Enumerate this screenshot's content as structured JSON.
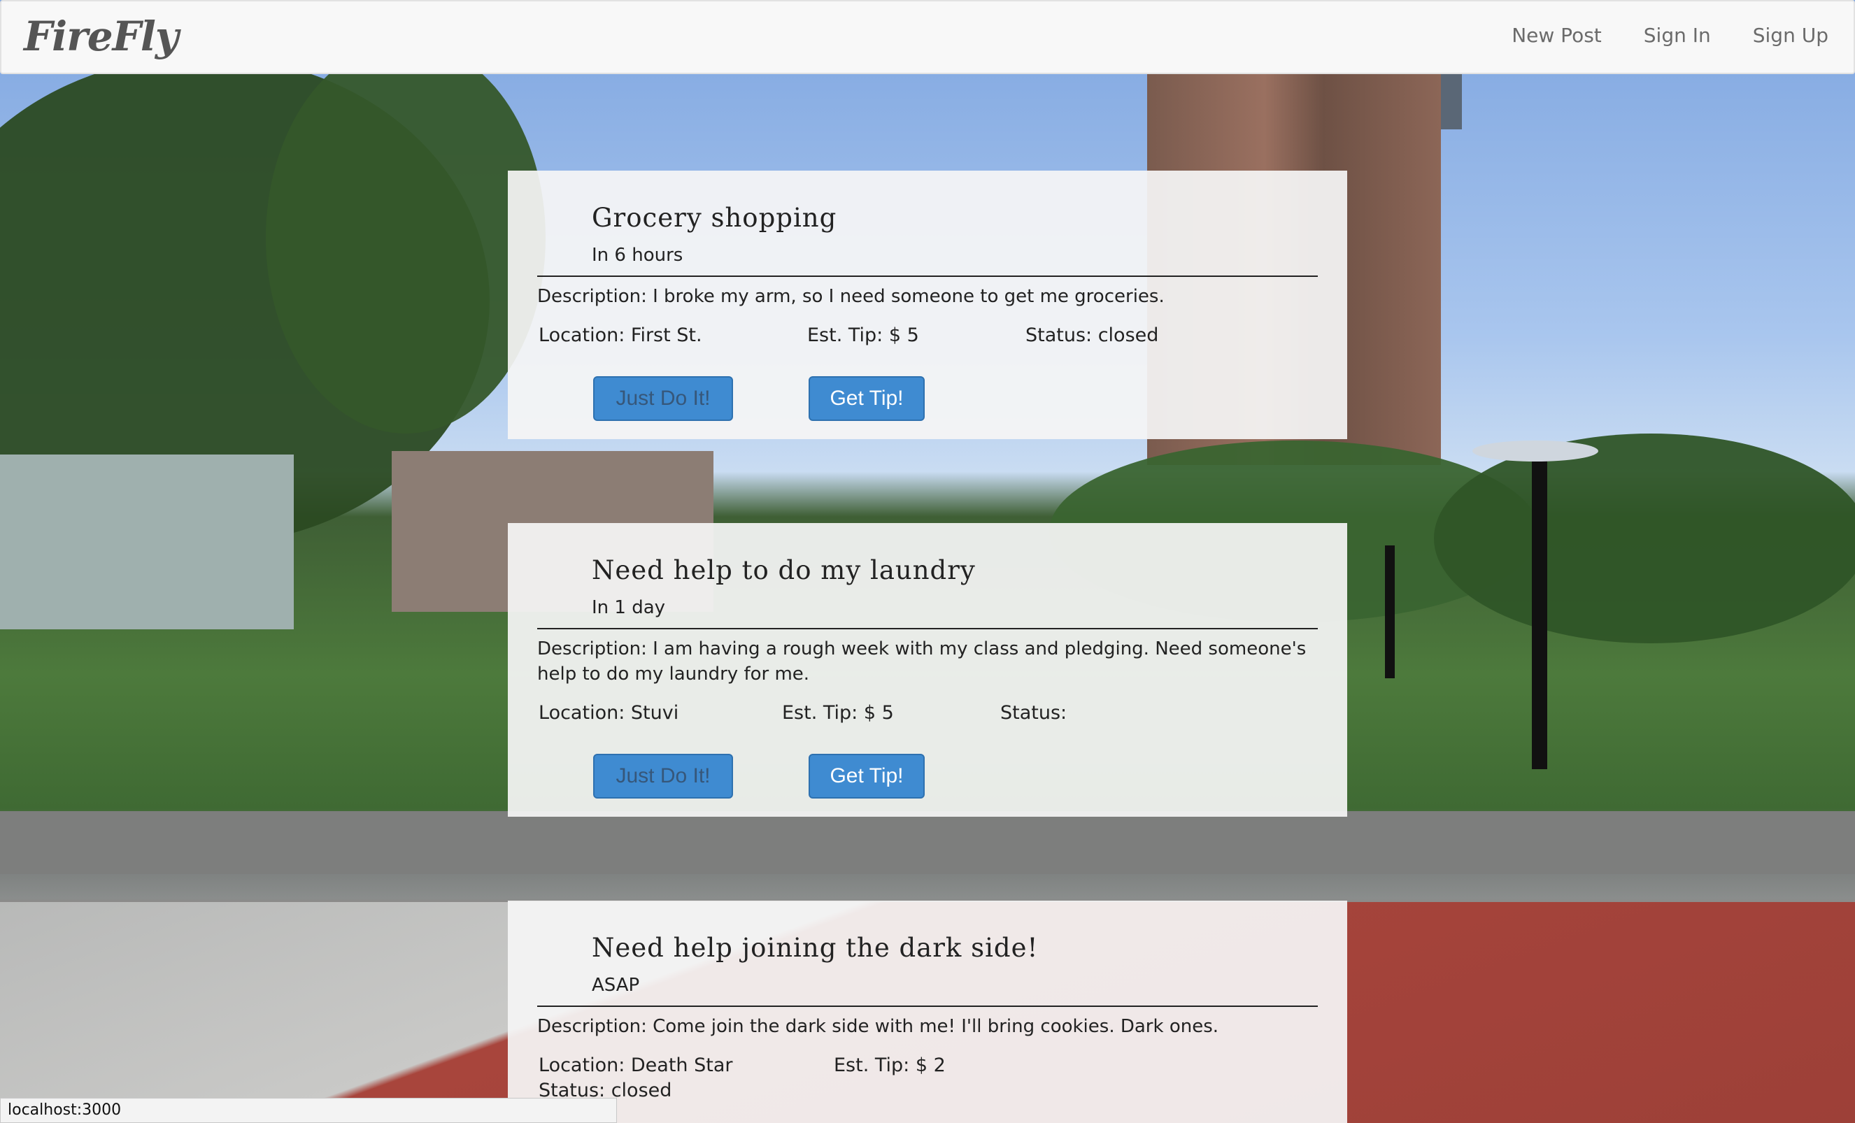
{
  "app": {
    "brand": "FireFly"
  },
  "nav": {
    "items": [
      "New Post",
      "Sign In",
      "Sign Up"
    ]
  },
  "posts": [
    {
      "title": "Grocery shopping",
      "when": "In 6 hours",
      "description": "Description: I broke my arm, so I need someone to get me groceries.",
      "location": "Location: First St.",
      "tip": "Est. Tip: $ 5",
      "status": "Status: closed",
      "do_label": "Just Do It!",
      "tip_label": "Get Tip!"
    },
    {
      "title": "Need help to do my laundry",
      "when": "In 1 day",
      "description": "Description: I am having a rough week with my class and pledging. Need someone's help to do my laundry for me.",
      "location": "Location: Stuvi",
      "tip": "Est. Tip: $ 5",
      "status": "Status:",
      "do_label": "Just Do It!",
      "tip_label": "Get Tip!"
    },
    {
      "title": "Need help joining the dark side!",
      "when": "ASAP",
      "description": "Description: Come join the dark side with me! I'll bring cookies. Dark ones.",
      "location": "Location: Death Star",
      "tip": "Est. Tip: $ 2",
      "status": "Status: closed"
    }
  ],
  "statusbar": {
    "url": "localhost:3000"
  },
  "colors": {
    "button": "#3f8bd1",
    "navbar": "#f8f8f8"
  }
}
